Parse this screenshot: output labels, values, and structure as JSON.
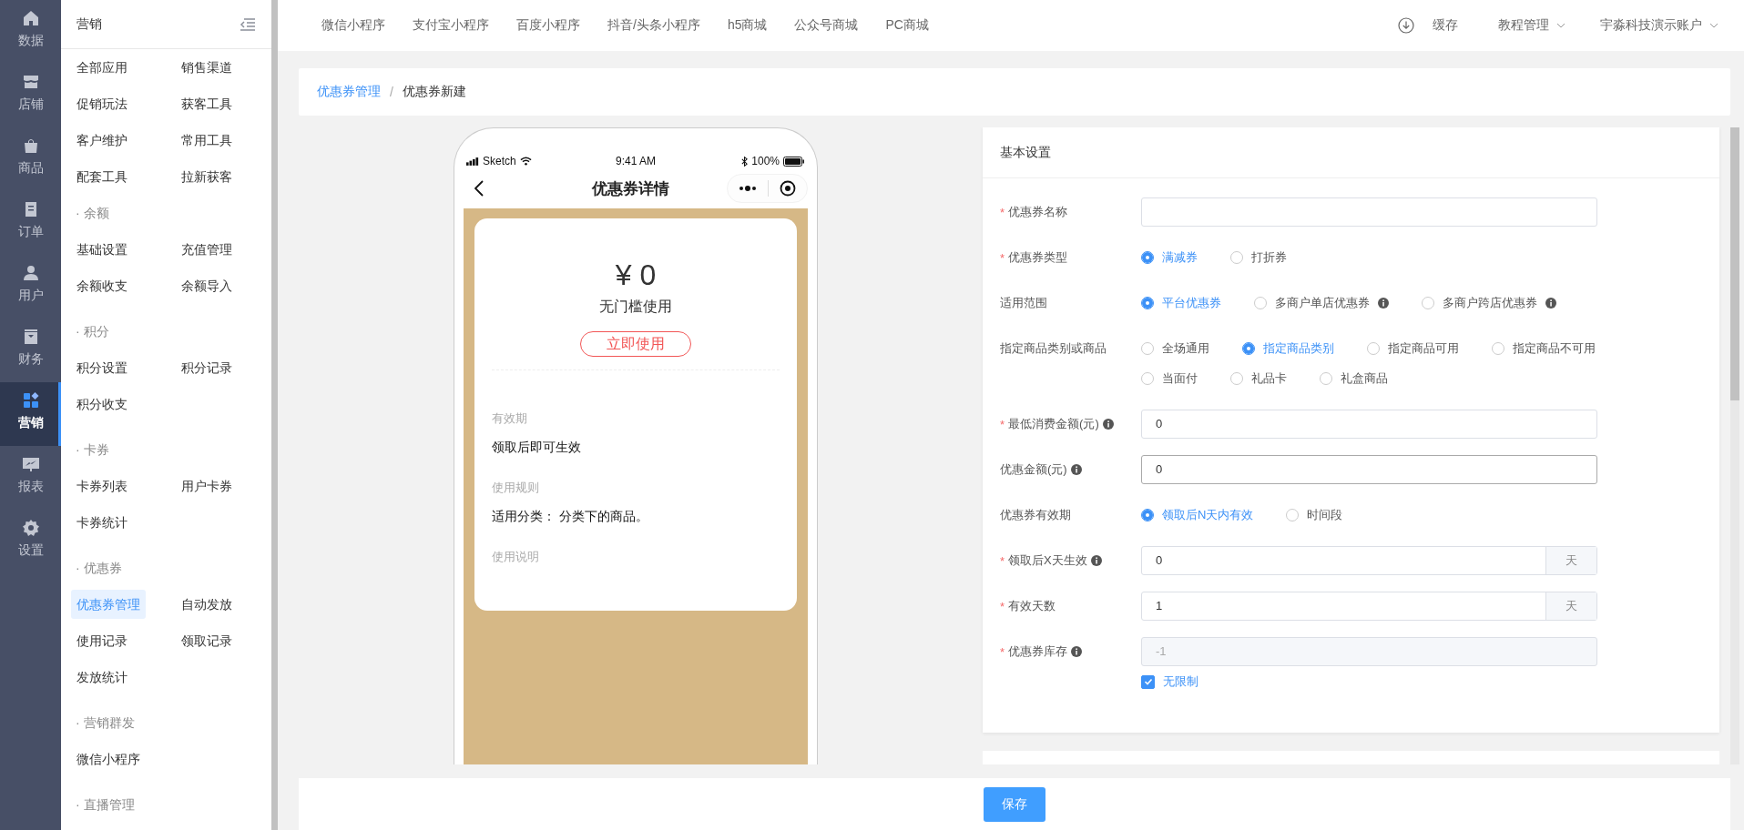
{
  "rail": [
    {
      "label": "数据",
      "selected": false
    },
    {
      "label": "店铺",
      "selected": false
    },
    {
      "label": "商品",
      "selected": false
    },
    {
      "label": "订单",
      "selected": false
    },
    {
      "label": "用户",
      "selected": false
    },
    {
      "label": "财务",
      "selected": false
    },
    {
      "label": "营销",
      "selected": true
    },
    {
      "label": "报表",
      "selected": false
    },
    {
      "label": "设置",
      "selected": false
    }
  ],
  "sidebar": {
    "title": "营销",
    "sections": [
      {
        "items": [
          {
            "label": "全部应用",
            "selected": false
          },
          {
            "label": "销售渠道",
            "selected": false
          },
          {
            "label": "促销玩法",
            "selected": false
          },
          {
            "label": "获客工具",
            "selected": false
          },
          {
            "label": "客户维护",
            "selected": false
          },
          {
            "label": "常用工具",
            "selected": false
          },
          {
            "label": "配套工具",
            "selected": false
          },
          {
            "label": "拉新获客",
            "selected": false
          }
        ]
      },
      {
        "heading": "· 余额",
        "items": [
          {
            "label": "基础设置",
            "selected": false
          },
          {
            "label": "充值管理",
            "selected": false
          },
          {
            "label": "余额收支",
            "selected": false
          },
          {
            "label": "余额导入",
            "selected": false
          }
        ]
      },
      {
        "heading": "· 积分",
        "items": [
          {
            "label": "积分设置",
            "selected": false
          },
          {
            "label": "积分记录",
            "selected": false
          },
          {
            "label": "积分收支",
            "selected": false
          }
        ]
      },
      {
        "heading": "· 卡券",
        "items": [
          {
            "label": "卡券列表",
            "selected": false
          },
          {
            "label": "用户卡券",
            "selected": false
          },
          {
            "label": "卡券统计",
            "selected": false
          }
        ]
      },
      {
        "heading": "· 优惠券",
        "items": [
          {
            "label": "优惠券管理",
            "selected": true
          },
          {
            "label": "自动发放",
            "selected": false
          },
          {
            "label": "使用记录",
            "selected": false
          },
          {
            "label": "领取记录",
            "selected": false
          },
          {
            "label": "发放统计",
            "selected": false
          }
        ]
      },
      {
        "heading": "· 营销群发",
        "items": [
          {
            "label": "微信小程序",
            "selected": false
          }
        ]
      },
      {
        "heading": "· 直播管理"
      }
    ]
  },
  "topbar": {
    "tabs": [
      "微信小程序",
      "支付宝小程序",
      "百度小程序",
      "抖音/头条小程序",
      "h5商城",
      "公众号商城",
      "PC商城"
    ],
    "cache": "缓存",
    "tutorial": "教程管理",
    "account": "宇淼科技演示账户"
  },
  "breadcrumb": {
    "items": [
      "优惠券管理",
      "优惠券新建"
    ],
    "separator": "/"
  },
  "phone": {
    "carrier": "Sketch",
    "time": "9:41 AM",
    "battery": "100%",
    "title": "优惠券详情",
    "amount": "¥ 0",
    "condition": "无门槛使用",
    "use_button": "立即使用",
    "sections": [
      {
        "label": "有效期",
        "value": "领取后即可生效"
      },
      {
        "label": "使用规则",
        "value": "适用分类：  分类下的商品。"
      },
      {
        "label": "使用说明"
      }
    ]
  },
  "form": {
    "title": "基本设置",
    "required_mark": "*",
    "fields": [
      {
        "kind": "text",
        "label": "优惠券名称",
        "required": true,
        "info": false,
        "focused": false
      },
      {
        "kind": "radio",
        "label": "优惠券类型",
        "required": true,
        "info": false,
        "options": [
          {
            "label": "满减券",
            "selected": true,
            "info": false
          },
          {
            "label": "打折券",
            "selected": false,
            "info": false
          }
        ]
      },
      {
        "kind": "radio",
        "label": "适用范围",
        "required": false,
        "info": false,
        "options": [
          {
            "label": "平台优惠券",
            "selected": true,
            "info": false
          },
          {
            "label": "多商户单店优惠券",
            "selected": false,
            "info": true
          },
          {
            "label": "多商户跨店优惠券",
            "selected": false,
            "info": true
          }
        ]
      },
      {
        "kind": "radio",
        "label": "指定商品类别或商品",
        "required": false,
        "info": false,
        "options": [
          {
            "label": "全场通用",
            "selected": false,
            "info": false
          },
          {
            "label": "指定商品类别",
            "selected": true,
            "info": false
          },
          {
            "label": "指定商品可用",
            "selected": false,
            "info": false
          },
          {
            "label": "指定商品不可用",
            "selected": false,
            "info": false
          },
          {
            "label": "当面付",
            "selected": false,
            "info": false
          },
          {
            "label": "礼品卡",
            "selected": false,
            "info": false
          },
          {
            "label": "礼盒商品",
            "selected": false,
            "info": false
          }
        ]
      },
      {
        "kind": "text",
        "label": "最低消费金额(元)",
        "required": true,
        "info": true,
        "value": "0",
        "focused": false
      },
      {
        "kind": "text",
        "label": "优惠金额(元)",
        "required": false,
        "info": true,
        "value": "0",
        "focused": true
      },
      {
        "kind": "radio",
        "label": "优惠券有效期",
        "required": false,
        "info": false,
        "options": [
          {
            "label": "领取后N天内有效",
            "selected": true,
            "info": false
          },
          {
            "label": "时间段",
            "selected": false,
            "info": false
          }
        ]
      },
      {
        "kind": "suffix",
        "label": "领取后X天生效",
        "required": true,
        "info": true,
        "value": "0",
        "suffix": "天"
      },
      {
        "kind": "suffix",
        "label": "有效天数",
        "required": true,
        "info": false,
        "value": "1",
        "suffix": "天"
      },
      {
        "kind": "disabled",
        "label": "优惠券库存",
        "required": true,
        "info": true,
        "value": "-1",
        "checkbox": {
          "label": "无限制",
          "checked": true
        }
      }
    ]
  },
  "save_button": "保存"
}
